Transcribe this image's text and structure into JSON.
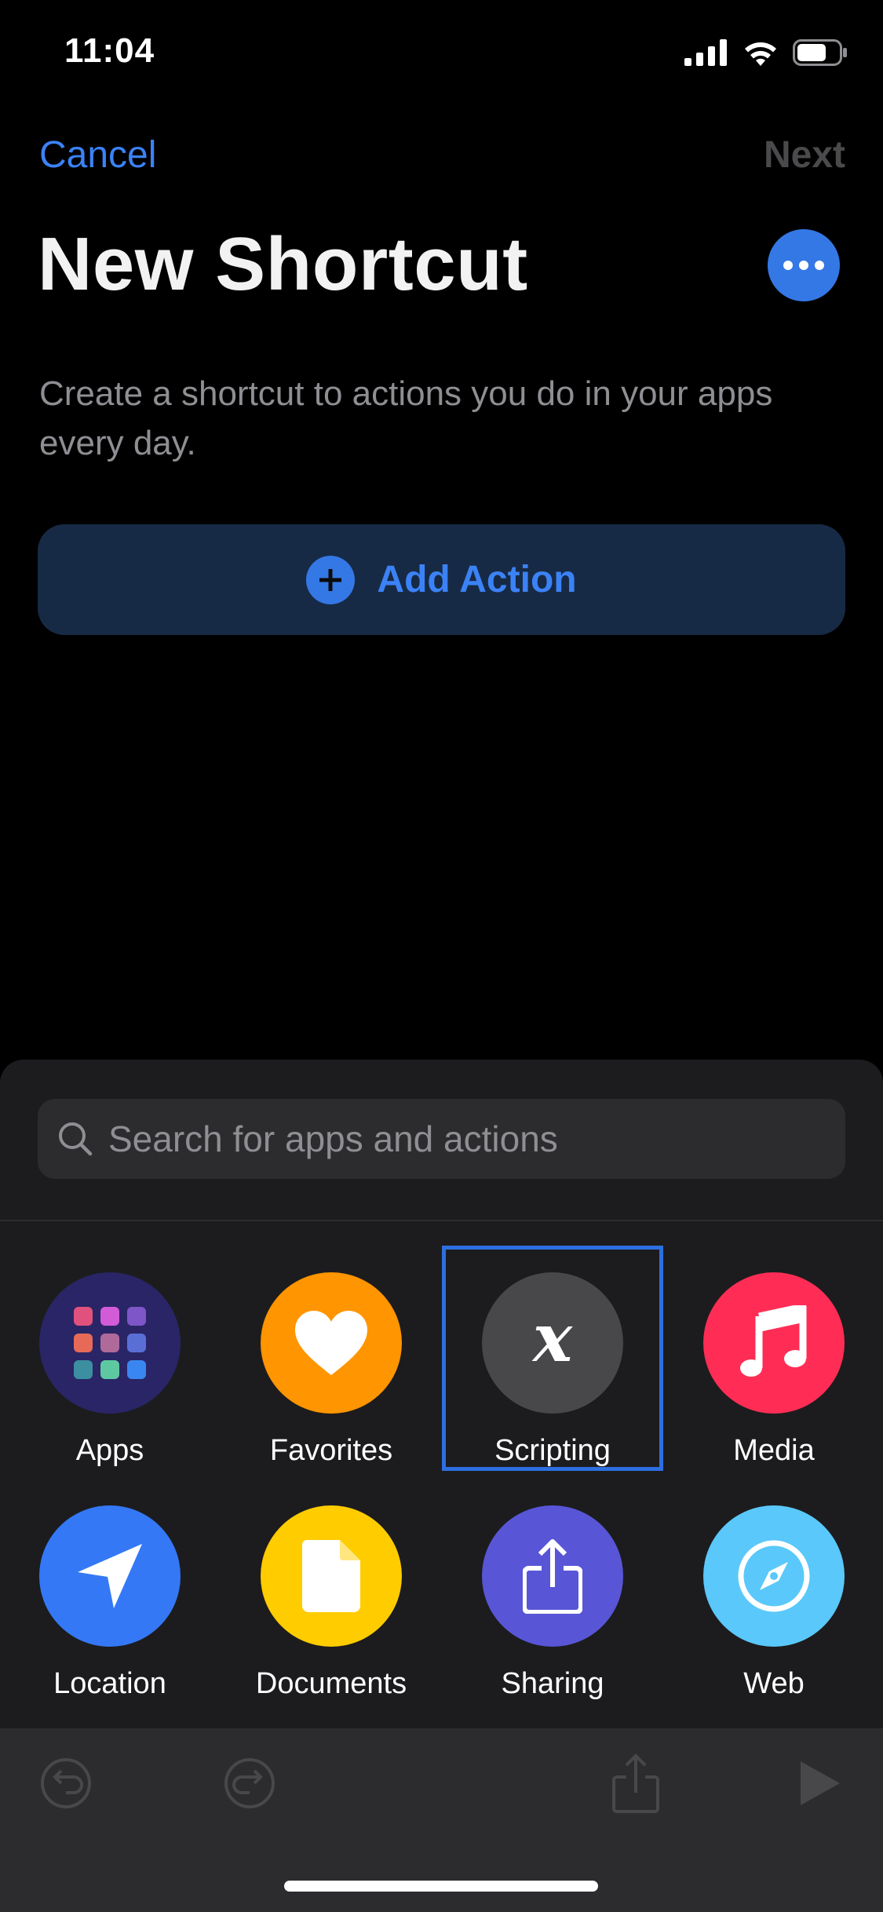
{
  "status_bar": {
    "time": "11:04"
  },
  "nav": {
    "cancel_label": "Cancel",
    "next_label": "Next"
  },
  "header": {
    "title": "New Shortcut",
    "description": "Create a shortcut to actions you do in your apps every day."
  },
  "add_action": {
    "label": "Add Action"
  },
  "search": {
    "placeholder": "Search for apps and actions",
    "value": ""
  },
  "categories": [
    {
      "label": "Apps",
      "icon": "apps-grid-icon",
      "color": "#2a2566"
    },
    {
      "label": "Favorites",
      "icon": "heart-icon",
      "color": "#ff9500"
    },
    {
      "label": "Scripting",
      "icon": "variable-x-icon",
      "color": "#48484a",
      "selected": true
    },
    {
      "label": "Media",
      "icon": "music-note-icon",
      "color": "#ff2d55"
    },
    {
      "label": "Location",
      "icon": "location-arrow-icon",
      "color": "#3478f6"
    },
    {
      "label": "Documents",
      "icon": "document-icon",
      "color": "#ffcc00"
    },
    {
      "label": "Sharing",
      "icon": "share-icon",
      "color": "#5856d6"
    },
    {
      "label": "Web",
      "icon": "compass-icon",
      "color": "#5ac8fa"
    }
  ],
  "toolbar": {
    "items": [
      "undo-icon",
      "redo-icon",
      "share-icon",
      "play-icon"
    ]
  },
  "colors": {
    "accent": "#3478e5",
    "background": "#000000",
    "sheet": "#1c1c1e"
  }
}
